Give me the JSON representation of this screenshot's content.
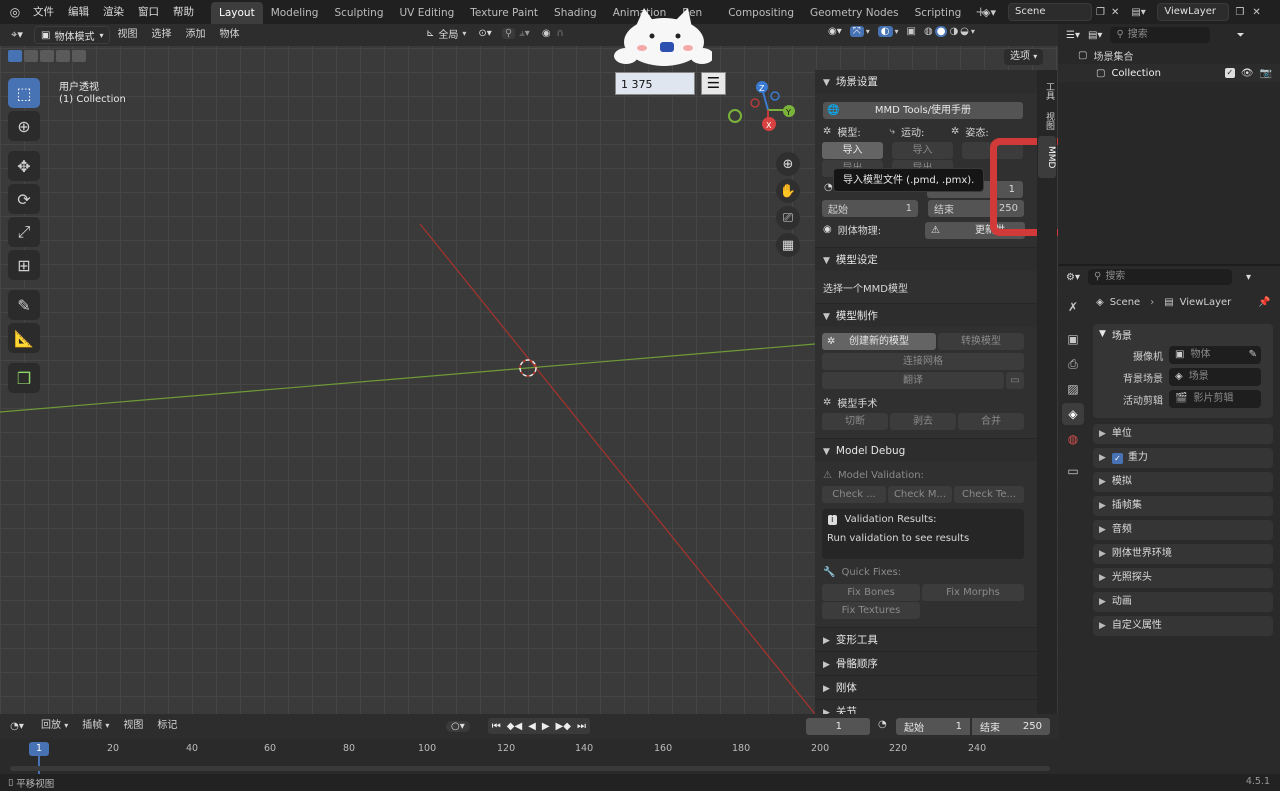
{
  "top_menu": [
    "文件",
    "编辑",
    "渲染",
    "窗口",
    "帮助"
  ],
  "workspace_tabs": [
    "Layout",
    "Modeling",
    "Sculpting",
    "UV Editing",
    "Texture Paint",
    "Shading",
    "Animation",
    "Ren",
    "Compositing",
    "Geometry Nodes",
    "Scripting"
  ],
  "active_tab": "Layout",
  "scene_name": "Scene",
  "viewlayer_name": "ViewLayer",
  "viewport": {
    "mode": "物体模式",
    "menus": [
      "视图",
      "选择",
      "添加",
      "物体"
    ],
    "transform_orientation": "全局",
    "options_label": "选项",
    "view_name": "用户透视",
    "collection_info": "(1) Collection",
    "number_field": "1 375"
  },
  "npanel": {
    "scene_settings": "场景设置",
    "manual_button": "MMD Tools/使用手册",
    "model_label": "模型:",
    "motion_label": "运动:",
    "pose_label": "姿态:",
    "import_label": "导入",
    "export_label": "导出",
    "tooltip": "导入模型文件 (.pmd, .pmx).",
    "frame_value": "1",
    "start_label": "起始",
    "start_value": "1",
    "end_label": "结束",
    "end_value": "250",
    "rigid_label": "刚体物理:",
    "update_label": "更新世",
    "model_settings": "模型设定",
    "select_model": "选择一个MMD模型",
    "model_making": "模型制作",
    "create_model": "创建新的模型",
    "convert_model": "转换模型",
    "join_mesh": "连接网格",
    "translate": "翻译",
    "surgery": "模型手术",
    "cut": "切断",
    "strip": "剥去",
    "merge": "合并",
    "model_debug": "Model Debug",
    "model_validation": "Model Validation:",
    "check1": "Check ...",
    "check2": "Check M...",
    "check3": "Check Te...",
    "validation_results": "Validation Results:",
    "run_validation": "Run validation to see results",
    "quick_fixes": "Quick Fixes:",
    "fix_bones": "Fix Bones",
    "fix_morphs": "Fix Morphs",
    "fix_textures": "Fix Textures",
    "deform_tools": "变形工具",
    "bone_order": "骨骼顺序",
    "rigid_body": "刚体",
    "joint": "关节"
  },
  "side_tabs": [
    "工具",
    "视图",
    "MMD"
  ],
  "timeline": {
    "menus": [
      "回放",
      "插帧",
      "视图",
      "标记"
    ],
    "current_frame": "1",
    "start_label": "起始",
    "start_value": "1",
    "end_label": "结束",
    "end_value": "250",
    "ticks": [
      "20",
      "40",
      "60",
      "80",
      "100",
      "120",
      "140",
      "160",
      "180",
      "200",
      "220",
      "240"
    ],
    "playhead": "1"
  },
  "status": {
    "left": "平移视图",
    "version": "4.5.1"
  },
  "outliner": {
    "search_placeholder": "搜索",
    "scene_collection": "场景集合",
    "collection": "Collection"
  },
  "properties": {
    "search_placeholder": "搜索",
    "breadcrumb_scene": "Scene",
    "breadcrumb_layer": "ViewLayer",
    "scene_section": "场景",
    "camera_label": "摄像机",
    "camera_value": "物体",
    "bg_label": "背景场景",
    "bg_value": "场景",
    "clip_label": "活动剪辑",
    "clip_value": "影片剪辑",
    "sections": [
      "单位",
      "重力",
      "模拟",
      "插帧集",
      "音频",
      "刚体世界环境",
      "光照探头",
      "动画",
      "自定义属性"
    ]
  },
  "colors": {
    "accent": "#4772b3",
    "highlight_box": "#d23a3a",
    "x_axis": "#c0392b",
    "y_axis": "#7bb33a"
  }
}
